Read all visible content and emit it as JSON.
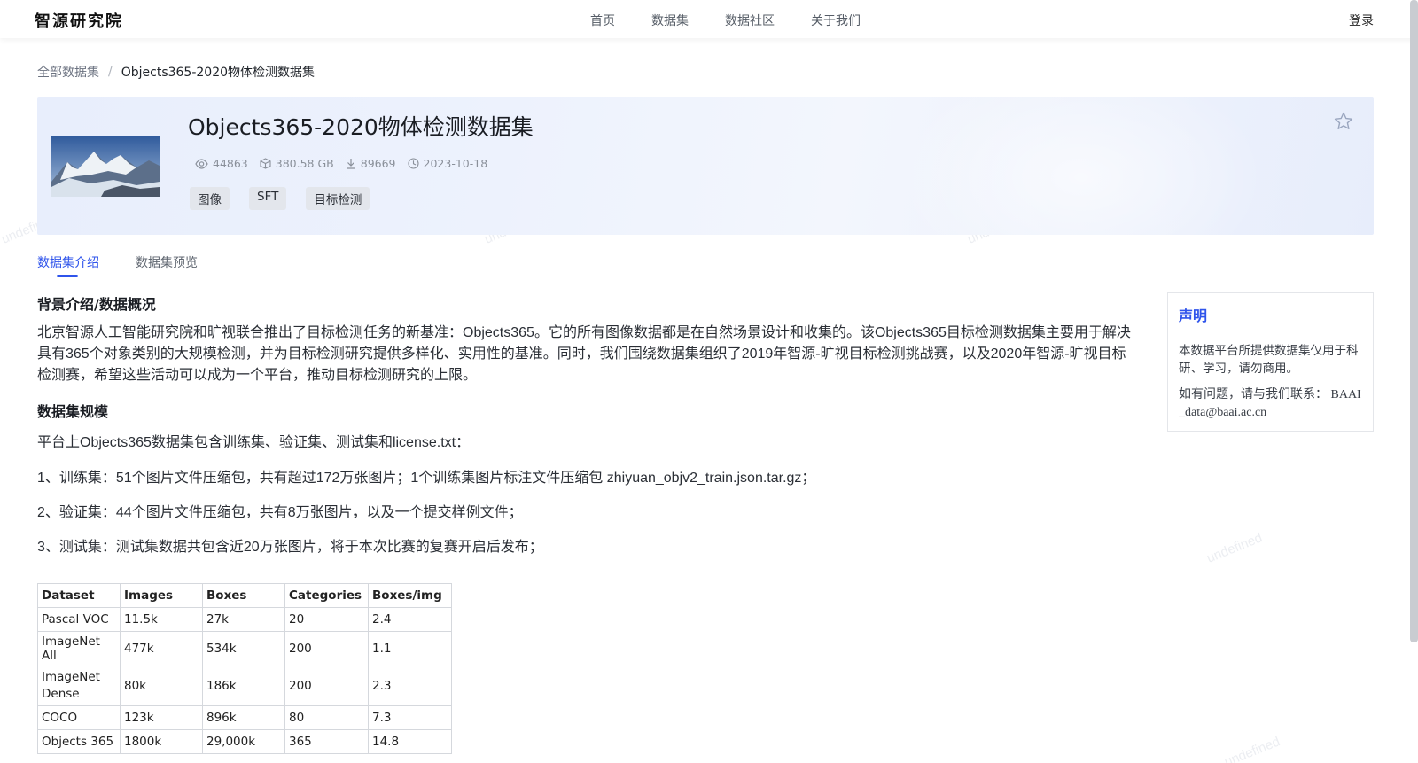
{
  "watermark": "undefined",
  "header": {
    "logo": "智源研究院",
    "nav": [
      "首页",
      "数据集",
      "数据社区",
      "关于我们"
    ],
    "login": "登录"
  },
  "breadcrumb": {
    "root": "全部数据集",
    "separator": "/",
    "current": "Objects365-2020物体检测数据集"
  },
  "dataset": {
    "title": "Objects365-2020物体检测数据集",
    "views": "44863",
    "size": "380.58 GB",
    "downloads": "89669",
    "date": "2023-10-18",
    "tags": [
      "图像",
      "SFT",
      "目标检测"
    ]
  },
  "tabs": [
    "数据集介绍",
    "数据集预览"
  ],
  "content": {
    "intro_heading": "背景介绍/数据概况",
    "intro_text": "北京智源人工智能研究院和旷视联合推出了目标检测任务的新基准：Objects365。它的所有图像数据都是在自然场景设计和收集的。该Objects365目标检测数据集主要用于解决具有365个对象类别的大规模检测，并为目标检测研究提供多样化、实用性的基准。同时，我们围绕数据集组织了2019年智源-旷视目标检测挑战赛，以及2020年智源-旷视目标检测赛，希望这些活动可以成为一个平台，推动目标检测研究的上限。",
    "scale_heading": "数据集规模",
    "scale_intro": "平台上Objects365数据集包含训练集、验证集、测试集和license.txt：",
    "line1": "1、训练集：51个图片文件压缩包，共有超过172万张图片；1个训练集图片标注文件压缩包 zhiyuan_objv2_train.json.tar.gz；",
    "line2": "2、验证集：44个图片文件压缩包，共有8万张图片，以及一个提交样例文件；",
    "line3": "3、测试集：测试集数据共包含近20万张图片，将于本次比赛的复赛开启后发布；"
  },
  "table": {
    "headers": [
      "Dataset",
      "Images",
      "Boxes",
      "Categories",
      "Boxes/img"
    ],
    "rows": [
      [
        "Pascal VOC",
        "11.5k",
        "27k",
        "20",
        "2.4"
      ],
      [
        "ImageNet All",
        "477k",
        "534k",
        "200",
        "1.1"
      ],
      [
        "ImageNet Dense",
        "80k",
        "186k",
        "200",
        "2.3"
      ],
      [
        "COCO",
        "123k",
        "896k",
        "80",
        "7.3"
      ],
      [
        "Objects 365",
        "1800k",
        "29,000k",
        "365",
        "14.8"
      ]
    ]
  },
  "notice": {
    "title": "声明",
    "text": "本数据平台所提供数据集仅用于科研、学习，请勿商用。",
    "contact": "如有问题，请与我们联系： BAAI_data@baai.ac.cn"
  },
  "colors": {
    "accent": "#2f54eb"
  },
  "icons": [
    "eye-icon",
    "cube-icon",
    "download-icon",
    "clock-icon",
    "star-icon"
  ]
}
